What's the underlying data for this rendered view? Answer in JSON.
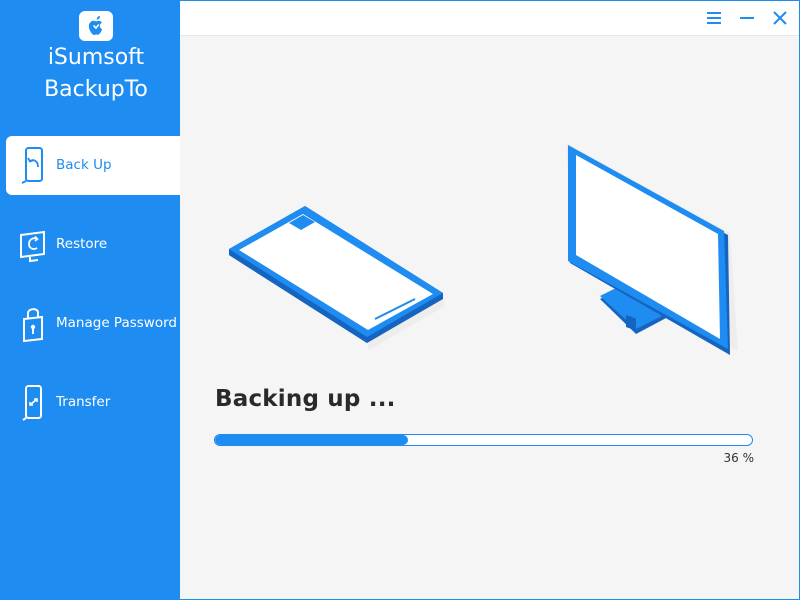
{
  "app": {
    "name_line1": "iSumsoft",
    "name_line2": "BackupTo"
  },
  "sidebar": {
    "items": [
      {
        "label": "Back Up",
        "icon": "phone-backup-icon",
        "active": true
      },
      {
        "label": "Restore",
        "icon": "computer-restore-icon",
        "active": false
      },
      {
        "label": "Manage Password",
        "icon": "phone-lock-icon",
        "active": false
      },
      {
        "label": "Transfer",
        "icon": "phone-transfer-icon",
        "active": false
      }
    ]
  },
  "titlebar": {
    "menu_icon": "menu-icon",
    "minimize_icon": "minimize-icon",
    "close_icon": "close-icon"
  },
  "main": {
    "status_title": "Backing up ...",
    "progress_percent": 36,
    "progress_text": "36 %"
  },
  "colors": {
    "accent": "#1e8cf0",
    "accent_dark": "#1565c0",
    "background": "#f5f5f5"
  }
}
